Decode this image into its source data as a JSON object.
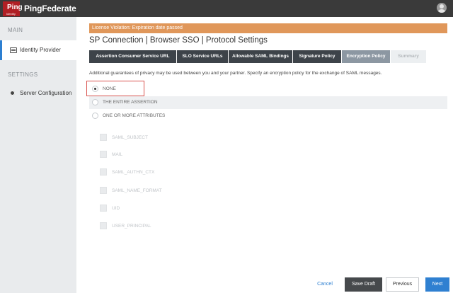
{
  "header": {
    "logo_text": "Ping",
    "logo_sub": "Identity",
    "brand": "PingFederate"
  },
  "sidebar": {
    "main_label": "MAIN",
    "identity_provider": "Identity Provider",
    "settings_label": "SETTINGS",
    "server_configuration": "Server Configuration"
  },
  "banner": "License Violation: Expiration date passed",
  "title": "SP Connection | Browser SSO | Protocol Settings",
  "tabs": [
    {
      "label": "Assertion Consumer Service URL"
    },
    {
      "label": "SLO Service URLs"
    },
    {
      "label": "Allowable SAML Bindings"
    },
    {
      "label": "Signature Policy"
    },
    {
      "label": "Encryption Policy"
    },
    {
      "label": "Summary"
    }
  ],
  "description": "Additional guarantees of privacy may be used between you and your partner. Specify an encryption policy for the exchange of SAML messages.",
  "options": {
    "none": "NONE",
    "entire_assertion": "THE ENTIRE ASSERTION",
    "one_or_more": "ONE OR MORE ATTRIBUTES"
  },
  "selected_option": "NONE",
  "attributes": [
    "SAML_SUBJECT",
    "MAIL",
    "SAML_AUTHN_CTX",
    "SAML_NAME_FORMAT",
    "UID",
    "USER_PRINCIPAL"
  ],
  "buttons": {
    "cancel": "Cancel",
    "save_draft": "Save Draft",
    "previous": "Previous",
    "next": "Next"
  },
  "colors": {
    "banner": "#e0975a",
    "active_tab": "#8c97a2",
    "primary": "#2f80d1",
    "highlight": "#d9534f"
  }
}
